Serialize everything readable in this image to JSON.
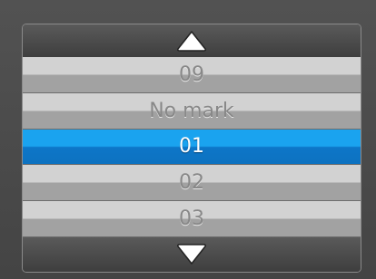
{
  "picker": {
    "scroll_up_icon": "triangle-up-icon",
    "scroll_down_icon": "triangle-down-icon",
    "items": [
      {
        "label": "09",
        "selected": false
      },
      {
        "label": "No mark",
        "selected": false
      },
      {
        "label": "01",
        "selected": true
      },
      {
        "label": "02",
        "selected": false
      },
      {
        "label": "03",
        "selected": false
      }
    ]
  }
}
